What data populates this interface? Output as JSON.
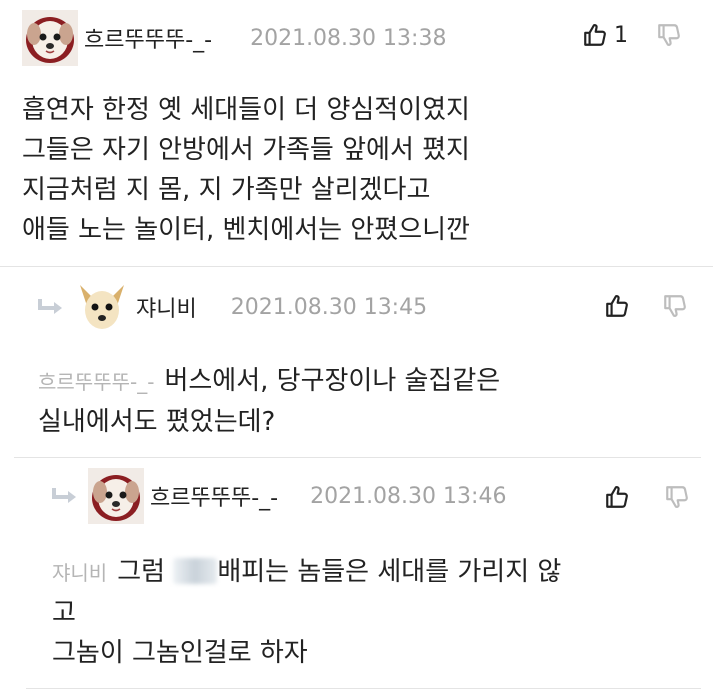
{
  "comments": [
    {
      "author": "흐르뚜뚜뚜-_-",
      "date": "2021.08.30 13:38",
      "likes": "1",
      "avatar": "puppy-avatar",
      "lines": [
        "흡연자 한정 옛 세대들이 더 양심적이였지",
        "그들은 자기 안방에서 가족들 앞에서 폈지",
        "지금처럼 지 몸, 지 가족만 살리겠다고",
        "애들 노는 놀이터, 벤치에서는 안폈으니깐"
      ]
    },
    {
      "author": "쟈니비",
      "date": "2021.08.30 13:45",
      "avatar": "chihuahua-avatar",
      "mention": "흐르뚜뚜뚜-_-",
      "line1": "버스에서, 당구장이나 술집같은",
      "line2": "실내에서도 폈었는데?"
    },
    {
      "author": "흐르뚜뚜뚜-_-",
      "date": "2021.08.30 13:46",
      "avatar": "puppy-avatar",
      "mention": "쟈니비",
      "line1_a": "그럼",
      "line1_b": "배피는 놈들은 세대를 가리지 않",
      "line2": "고",
      "line3": "그놈이 그놈인걸로 하자"
    }
  ],
  "icons": {
    "like": "thumbs-up-icon",
    "dislike": "thumbs-down-icon",
    "reply": "reply-arrow-icon"
  },
  "colors": {
    "text": "#222222",
    "meta": "#a3a3a3",
    "mention": "#b5b5b5",
    "divider": "#e4e4e4"
  }
}
